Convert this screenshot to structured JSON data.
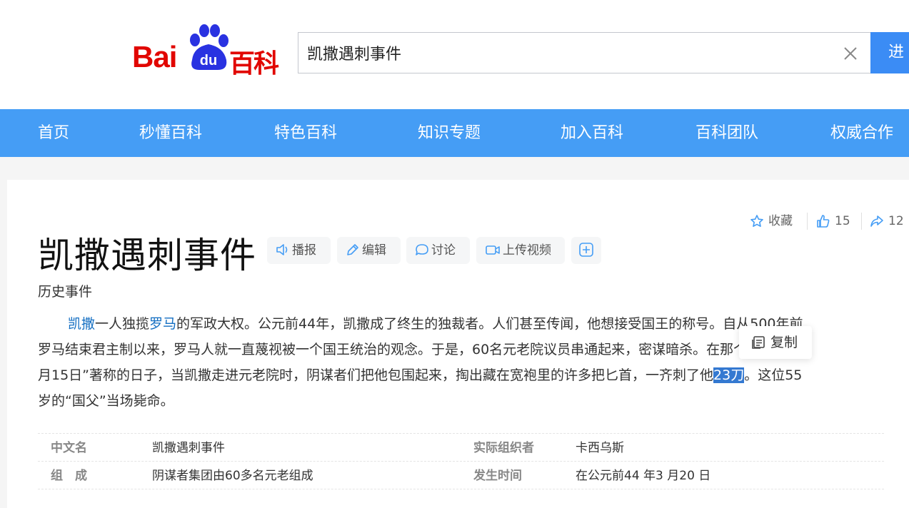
{
  "header": {
    "logo": {
      "text_bai": "Bai",
      "text_du": "du",
      "text_baike": "百科"
    },
    "search": {
      "value": "凯撒遇刺事件",
      "button_label": "进"
    }
  },
  "nav": {
    "items": [
      "首页",
      "秒懂百科",
      "特色百科",
      "知识专题",
      "加入百科",
      "百科团队",
      "权威合作"
    ]
  },
  "article": {
    "title": "凯撒遇刺事件",
    "actions": {
      "broadcast": "播报",
      "edit": "编辑",
      "discuss": "讨论",
      "upload_video": "上传视频"
    },
    "side_actions": {
      "collect": "收藏",
      "likes": "15",
      "shares": "12"
    },
    "subtitle": "历史事件",
    "summary": {
      "l1_link1": "凯撒",
      "l1_t1": "一人独揽",
      "l1_link2": "罗马",
      "l1_t2": "的军政大权。公元前44年，凯撒成了终生的独裁者。人们甚至传闻，他想接受国王的称号。自从500年前",
      "l2": "罗马结束君主制以来，罗马人就一直蔑视被一个国王统治的观念。于是，60名元老院议员串通起来，密谋暗杀。在那个以“3",
      "l3_t1": "月15日”著称的日子，当凯撒走进元老院时，阴谋者们把他包围起来，掏出藏在宽袍里的许多把匕首，一齐刺了他",
      "l3_hl": "23刀",
      "l3_t2": "。这位55",
      "l4": "岁的“国父”当场毙命。"
    },
    "copy_popup": "复制",
    "info": {
      "rows": [
        {
          "k1": "中文名",
          "v1": "凯撒遇刺事件",
          "k2": "实际组织者",
          "v2": "卡西乌斯"
        },
        {
          "k1": "组　成",
          "v1": "阴谋者集团由60多名元老组成",
          "k2": "发生时间",
          "v2": "在公元前44 年3 月20 日"
        }
      ]
    }
  },
  "colors": {
    "nav_bg": "#459df5",
    "logo_red": "#e10601",
    "logo_blue": "#2932e1",
    "link": "#136ec2",
    "highlight": "#3479d1"
  }
}
